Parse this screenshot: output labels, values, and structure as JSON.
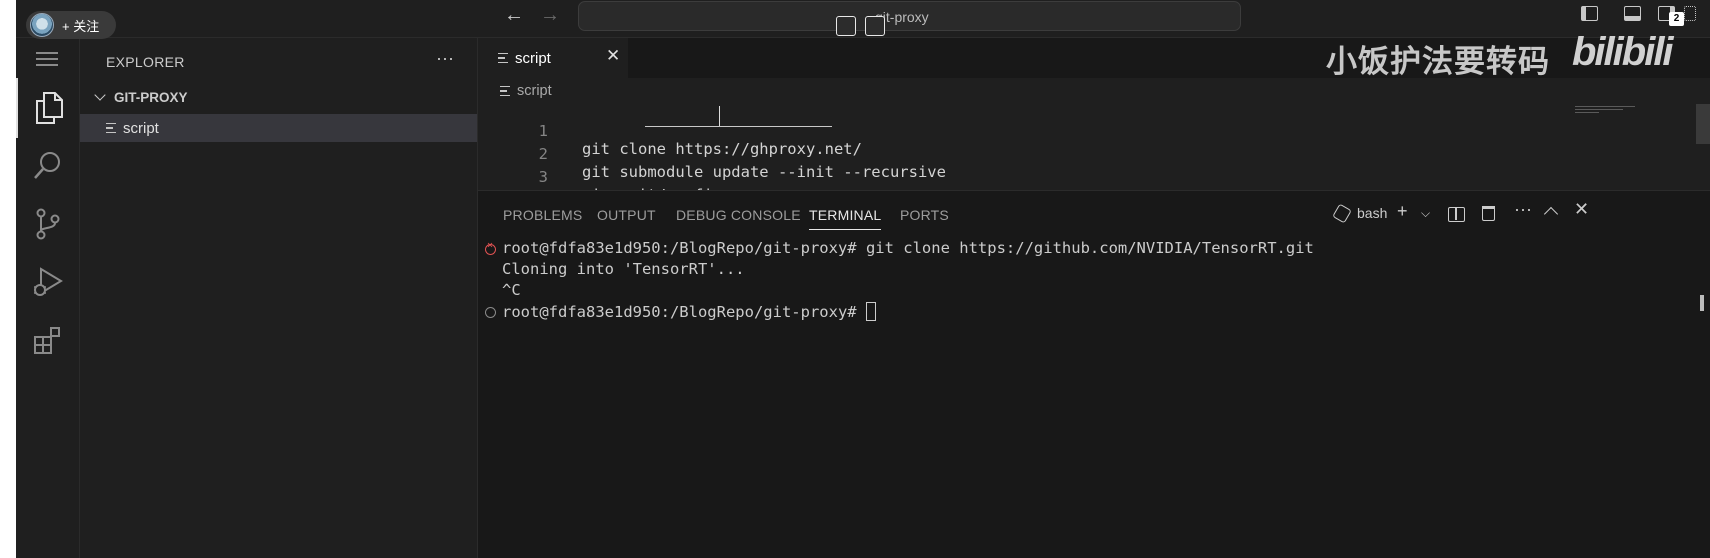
{
  "overlay": {
    "follow_label": "+ 关注",
    "watermark_text": "小饭护法要转码",
    "watermark_logo": "bilibili",
    "notification_count": "2"
  },
  "titlebar": {
    "back_icon": "arrow-left-icon",
    "forward_icon": "arrow-right-icon",
    "search_text": "git-proxy"
  },
  "activity_bar": {
    "items": [
      {
        "name": "explorer",
        "icon": "files-icon"
      },
      {
        "name": "search",
        "icon": "search-icon"
      },
      {
        "name": "source-control",
        "icon": "source-control-icon"
      },
      {
        "name": "run-and-debug",
        "icon": "run-debug-icon"
      },
      {
        "name": "extensions",
        "icon": "extensions-icon"
      }
    ]
  },
  "sidebar": {
    "title": "EXPLORER",
    "more": "···",
    "folder": "GIT-PROXY",
    "files": [
      "script"
    ]
  },
  "editor": {
    "tab_label": "script",
    "tab_close": "✕",
    "breadcrumb": "script",
    "lines": [
      {
        "num": "1",
        "text": "git clone https://ghproxy.net/"
      },
      {
        "num": "2",
        "text": "git submodule update --init --recursive"
      },
      {
        "num": "3",
        "text": "vim .git/config"
      }
    ]
  },
  "panel": {
    "tabs": [
      "PROBLEMS",
      "OUTPUT",
      "DEBUG CONSOLE",
      "TERMINAL",
      "PORTS"
    ],
    "active_tab": "TERMINAL",
    "shell": "bash",
    "plus": "+",
    "more": "···",
    "close": "✕",
    "terminal_lines": [
      "root@fdfa83e1d950:/BlogRepo/git-proxy# git clone https://github.com/NVIDIA/TensorRT.git",
      "Cloning into 'TensorRT'...",
      "^C",
      "root@fdfa83e1d950:/BlogRepo/git-proxy# "
    ]
  },
  "colors": {
    "background": "#1f1f1f",
    "panel": "#181818",
    "selection": "#37373d",
    "error": "#e05252"
  }
}
